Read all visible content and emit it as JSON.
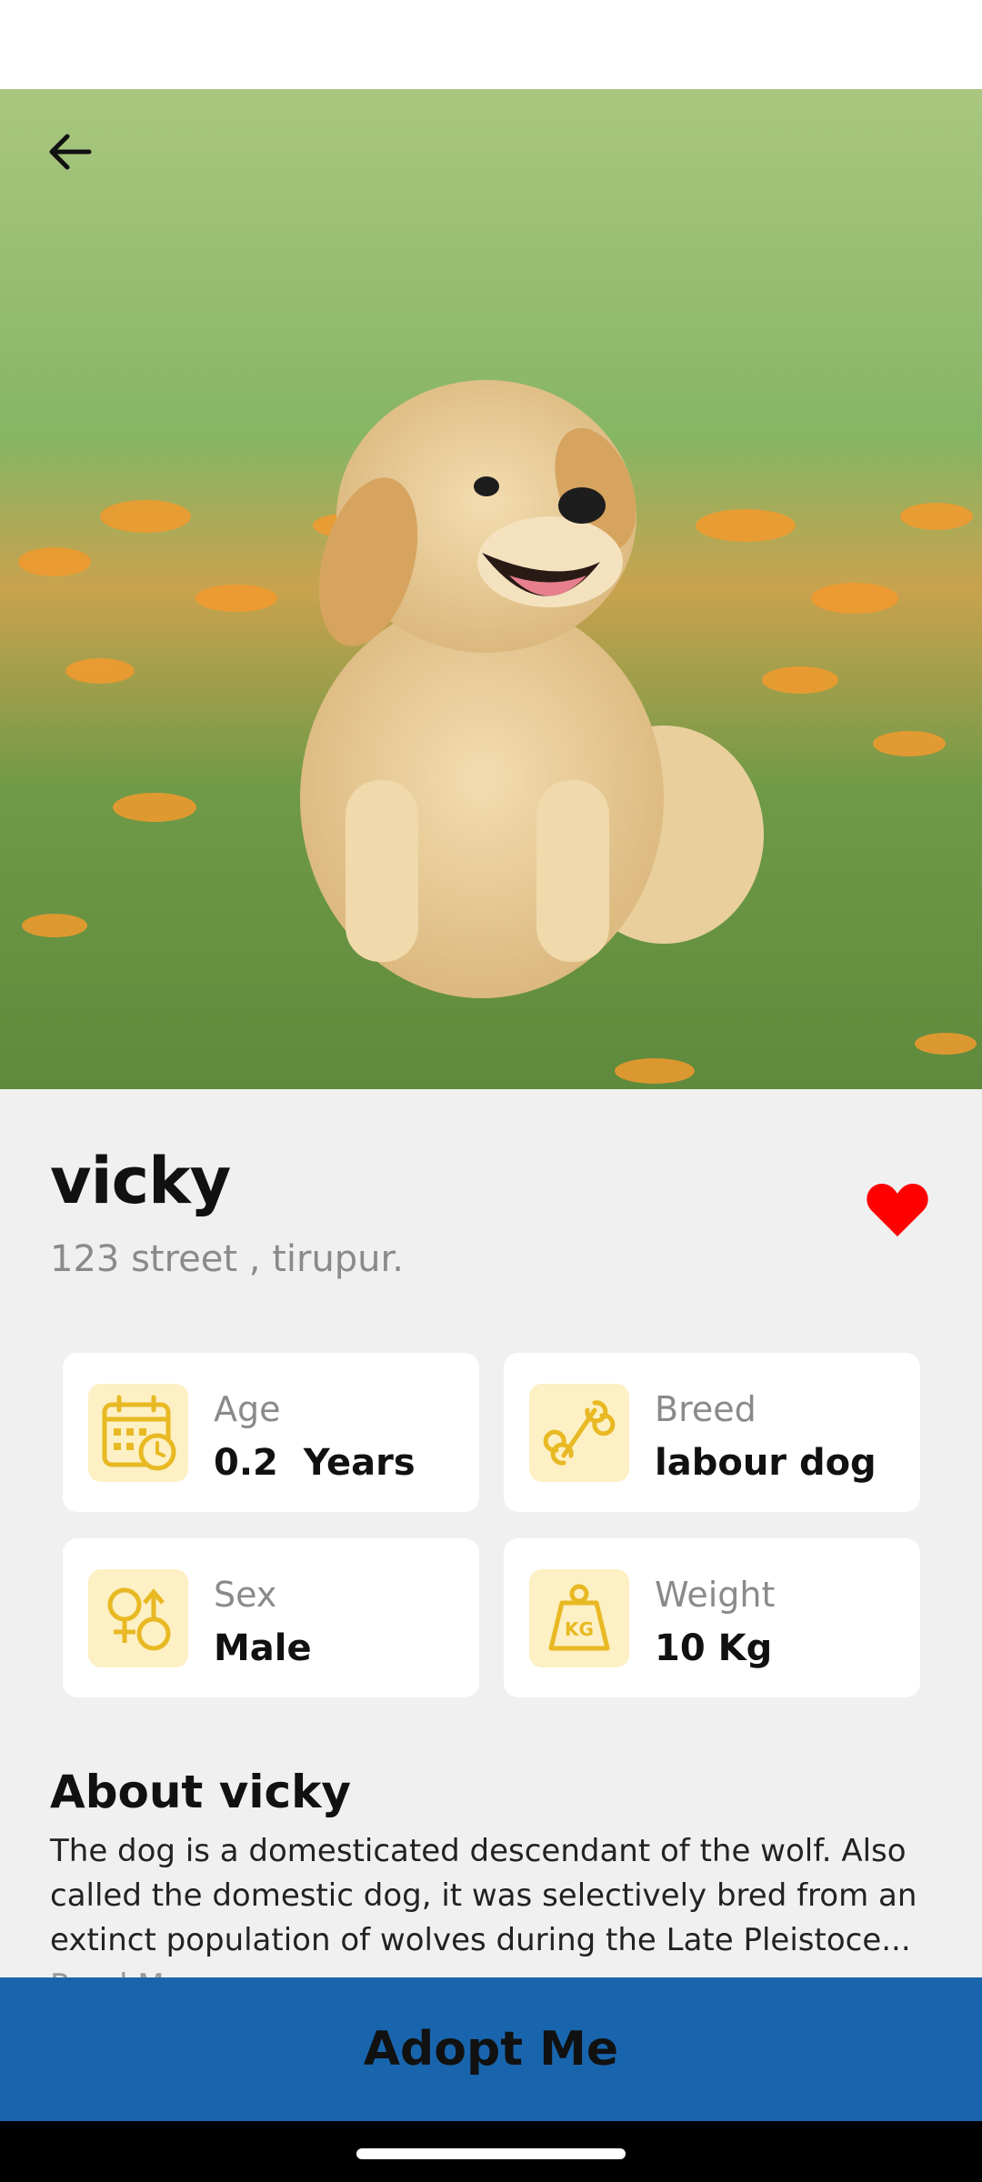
{
  "app": {
    "accent_color": "#1965ad",
    "favorite_color": "#ff0000",
    "icon_bg_color": "#fdf0c4",
    "icon_color": "#e8b923"
  },
  "header": {
    "back_icon": "arrow-left-icon"
  },
  "hero": {
    "image_subject": "golden retriever puppy sitting in grass with orange flowers"
  },
  "pet": {
    "name": "vicky",
    "location": "123 street , tirupur.",
    "favorite_icon": "heart-icon"
  },
  "details": [
    {
      "label": "Age",
      "value": "0.2  Years",
      "icon": "calendar-clock-icon"
    },
    {
      "label": "Breed",
      "value": "labour dog",
      "icon": "bone-icon"
    },
    {
      "label": "Sex",
      "value": "Male",
      "icon": "gender-icon"
    },
    {
      "label": "Weight",
      "value": "10 Kg",
      "icon": "weight-kg-icon"
    }
  ],
  "about": {
    "title": "About vicky",
    "text": "The dog is a domesticated descendant of the wolf. Also called the domestic dog, it was selectively bred from an extinct population of wolves during the Late Pleistoce...",
    "more_label": "Read More"
  },
  "cta": {
    "label": "Adopt Me"
  }
}
